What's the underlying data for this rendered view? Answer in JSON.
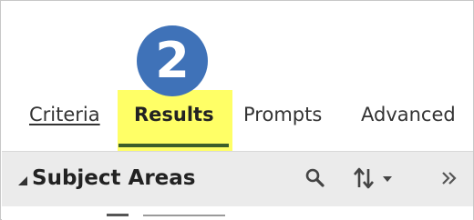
{
  "step_badge": {
    "number": "2"
  },
  "tabs": [
    {
      "label": "Criteria",
      "state": "link"
    },
    {
      "label": "Results",
      "state": "selected"
    },
    {
      "label": "Prompts",
      "state": "normal"
    },
    {
      "label": "Advanced",
      "state": "normal"
    }
  ],
  "pane": {
    "title": "Subject Areas",
    "toolbar_icons": [
      "search-icon",
      "sort-icon",
      "more-icon"
    ]
  },
  "colors": {
    "badge": "#3f72b8",
    "tab_highlight": "#ffff66",
    "tab_underline": "#3c5f2a",
    "toolbar_bg": "#ebebeb"
  }
}
